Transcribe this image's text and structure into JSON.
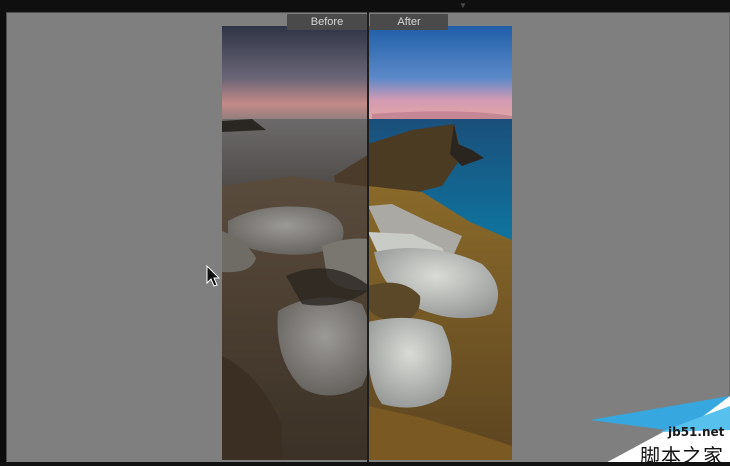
{
  "compare": {
    "before_label": "Before",
    "after_label": "After"
  },
  "watermark": {
    "site": "jb51.net",
    "cn_text": "脚本之家"
  },
  "colors": {
    "canvas_gray": "#7f7f7f",
    "label_bg": "#4a4a4a",
    "label_text": "#d8d8d8",
    "watermark_blue": "#36a7df"
  },
  "icons": {
    "top_handle": "chevron-down-icon",
    "cursor": "arrow-cursor-icon"
  }
}
